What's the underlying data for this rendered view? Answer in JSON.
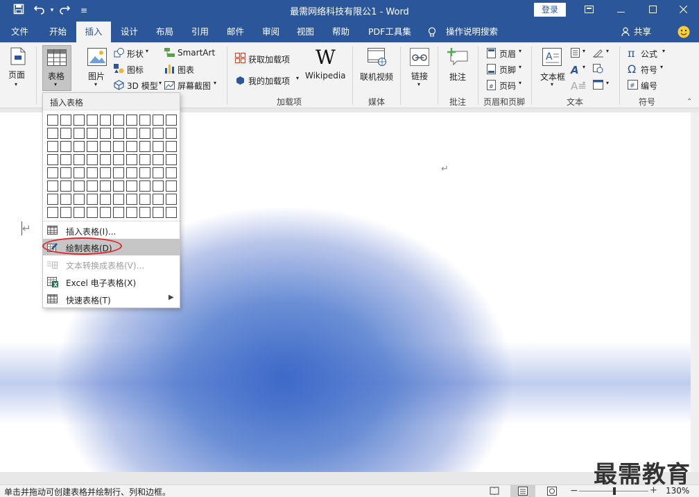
{
  "window": {
    "title": "最需网络科技有限公1 - Word",
    "login_label": "登录",
    "controls": [
      "▭",
      "—",
      "☐",
      "✕"
    ]
  },
  "quick_access": {
    "icons": [
      "save-icon",
      "undo-icon",
      "redo-icon",
      "customize-icon"
    ],
    "glyphs": [
      "💾",
      "↶",
      "↷",
      "≡"
    ]
  },
  "tabs": {
    "items": [
      "文件",
      "开始",
      "插入",
      "设计",
      "布局",
      "引用",
      "邮件",
      "审阅",
      "视图",
      "帮助",
      "PDF工具集"
    ],
    "active": "插入",
    "tell_me": "操作说明搜索",
    "share": "共享"
  },
  "ribbon": {
    "pages": "页面",
    "table": "表格",
    "pictures": "图片",
    "shapes": "形状",
    "icons": "图标",
    "model3d": "3D 模型",
    "smartart": "SmartArt",
    "chart": "图表",
    "screenshot": "屏幕截图",
    "get_addins": "获取加载项",
    "my_addins": "我的加载项",
    "wikipedia": "Wikipedia",
    "addins_group": "加载项",
    "online_video": "联机视频",
    "media_group": "媒体",
    "link": "链接",
    "comment": "批注",
    "comment_group": "批注",
    "header": "页眉",
    "footer": "页脚",
    "page_number": "页码",
    "header_footer_group": "页眉和页脚",
    "textbox": "文本框",
    "text_group": "文本",
    "equation": "公式",
    "symbol": "符号",
    "number": "编号",
    "symbols_group": "符号"
  },
  "dropdown": {
    "header": "插入表格",
    "grid_rows": 8,
    "grid_cols": 10,
    "items": [
      {
        "label": "插入表格(I)...",
        "icon": "table-grid-icon",
        "enabled": true,
        "highlighted": false
      },
      {
        "label": "绘制表格(D)",
        "icon": "draw-table-icon",
        "enabled": true,
        "highlighted": true
      },
      {
        "label": "文本转换成表格(V)...",
        "icon": "convert-text-icon",
        "enabled": false,
        "highlighted": false
      },
      {
        "label": "Excel 电子表格(X)",
        "icon": "excel-icon",
        "enabled": true,
        "highlighted": false
      },
      {
        "label": "快速表格(T)",
        "icon": "quick-table-icon",
        "enabled": true,
        "highlighted": false,
        "submenu": true
      }
    ]
  },
  "document": {
    "paragraph_mark": "↵"
  },
  "watermark": "最需教育",
  "status": {
    "text": "单击并拖动可创建表格并绘制行、列和边框。",
    "zoom": "130%"
  },
  "colors": {
    "brand": "#2b579a",
    "ribbon_bg": "#f3f3f3",
    "highlight": "#c6c6c6",
    "annotation_red": "#e0262a"
  }
}
